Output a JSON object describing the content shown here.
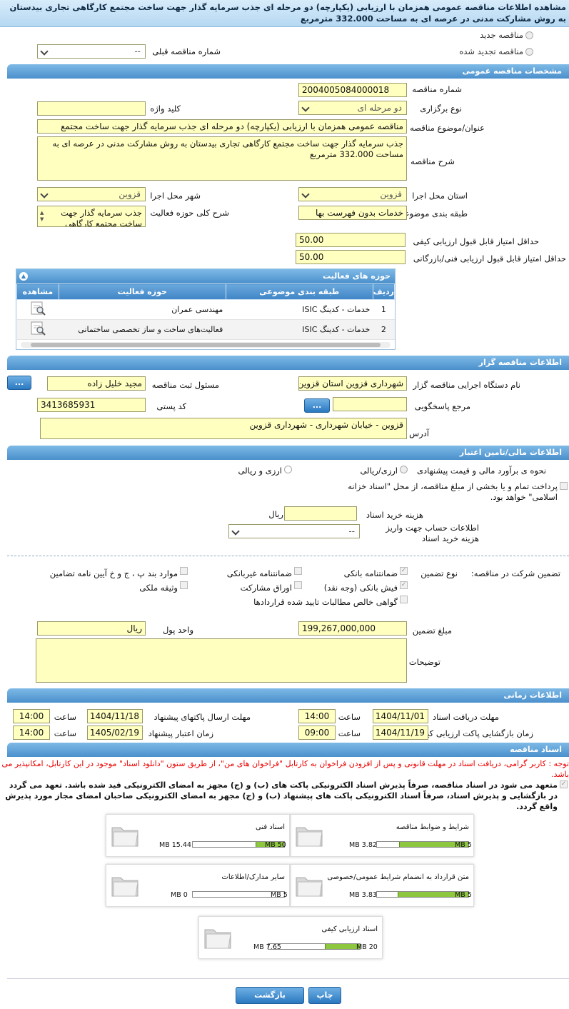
{
  "title": "مشاهده اطلاعات مناقصه عمومی همزمان با ارزیابی (یکپارچه) دو مرحله ای جذب سرمایه گذار جهت ساخت مجتمع کارگاهی تجاری بیدستان به روش مشارکت مدنی در عرصه ای به مساحت 332.000 مترمربع",
  "top": {
    "new_tender": "مناقصه جدید",
    "renewed_tender": "مناقصه تجدید شده",
    "prev_tender_label": "شماره مناقصه قبلی",
    "prev_tender_value": "--"
  },
  "sections": {
    "general": "مشخصات مناقصه عمومی",
    "organizer": "اطلاعات مناقصه گزار",
    "financial": "اطلاعات مالی/تامین اعتبار",
    "timing": "اطلاعات زمانی",
    "documents": "اسناد مناقصه"
  },
  "general": {
    "tender_number_label": "شماره مناقصه",
    "tender_number": "2004005084000018",
    "type_label": "نوع برگزاری",
    "type_value": "دو مرحله ای",
    "keyword_label": "کلید واژه",
    "keyword_value": "",
    "subject_label": "عنوان/موضوع مناقصه",
    "subject_value": "مناقصه عمومی همزمان با ارزیابی (یکپارچه) دو مرحله ای جذب سرمایه گذار جهت ساخت مجتمع",
    "desc_label": "شرح مناقصه",
    "desc_value": "جذب سرمایه گذار جهت ساخت مجتمع کارگاهی تجاری بیدستان  به روش مشارکت مدنی در عرصه ای به مساحت 332.000 مترمربع",
    "province_label": "استان محل اجرا",
    "province_value": "قزوین",
    "city_label": "شهر محل اجرا",
    "city_value": "قزوین",
    "category_label": "طبقه بندی موضوعی",
    "category_value": "خدمات بدون فهرست بها",
    "activity_desc_label": "شرح کلی حوزه فعالیت",
    "activity_desc_value": "جذب سرمایه گذار جهت ساخت مجتمع کارگاهی",
    "min_quality_label": "حداقل امتیاز قابل قبول ارزیابی کیفی",
    "min_quality_value": "50.00",
    "min_tech_label": "حداقل امتیاز قابل قبول ارزیابی فنی/بازرگانی",
    "min_tech_value": "50.00"
  },
  "activity_table": {
    "title": "حوزه های فعالیت",
    "headers": [
      "ردیف",
      "طبقه بندی موضوعی",
      "حوزه فعالیت",
      "مشاهده"
    ],
    "rows": [
      {
        "idx": "1",
        "category": "خدمات - کدینگ ISIC",
        "field": "مهندسی عمران"
      },
      {
        "idx": "2",
        "category": "خدمات - کدینگ ISIC",
        "field": "فعالیت‌های ساخت و ساز تخصصی ساختمانی"
      }
    ]
  },
  "organizer": {
    "org_label": "نام دستگاه اجرایی مناقصه گزار",
    "org_value": "شهرداری قزوین استان قزوین",
    "resp_label": "مسئول ثبت مناقصه",
    "resp_value": "مجید خلیل زاده",
    "ref_label": "مرجع پاسخگویی",
    "ref_value": "",
    "postal_label": "کد پستی",
    "postal_value": "3413685931",
    "address_label": "آدرس",
    "address_value": "قزوین - خیابان شهرداری - شهرداری قزوین",
    "btn_dots": "..."
  },
  "financial": {
    "estimate_label": "نحوه ی برآورد مالی و قیمت پیشنهادی",
    "opt1": "ارزی/ریالی",
    "opt2": "ارزی و ریالی",
    "treasury_text": "پرداخت تمام و یا بخشی از مبلغ مناقصه، از محل \"اسناد خزانه اسلامی\" خواهد بود.",
    "doc_cost_label": "هزینه خرید اسناد",
    "doc_cost_value": "",
    "doc_cost_unit": "ریال",
    "account_label": "اطلاعات حساب جهت واریز هزینه خرید اسناد",
    "account_value": "--"
  },
  "guarantee": {
    "label": "تضمین شرکت در مناقصه:",
    "type_label": "نوع تضمین",
    "options": [
      {
        "text": "ضمانتنامه بانکی",
        "checked": true
      },
      {
        "text": "ضمانتنامه غیربانکی",
        "checked": false
      },
      {
        "text": "موارد بند پ ، ج و خ آیین نامه تضامین",
        "checked": false
      },
      {
        "text": "فیش بانکی (وجه نقد)",
        "checked": true
      },
      {
        "text": "اوراق مشارکت",
        "checked": false
      },
      {
        "text": "وثیقه ملکی",
        "checked": false
      },
      {
        "text": "گواهی خالص مطالبات تایید شده قراردادها",
        "checked": false
      }
    ],
    "amount_label": "مبلغ تضمین",
    "amount_value": "199,267,000,000",
    "currency_label": "واحد پول",
    "currency_value": "ریال",
    "notes_label": "توضیحات",
    "notes_value": ""
  },
  "timing": {
    "receive_label": "مهلت دریافت اسناد",
    "receive_date": "1404/11/01",
    "receive_time": "14:00",
    "send_label": "مهلت ارسال پاکتهای پیشنهاد",
    "send_date": "1404/11/18",
    "send_time": "14:00",
    "open_label": "زمان بازگشایی پاکت ارزیابی کیفی",
    "open_date": "1404/11/19",
    "open_time": "09:00",
    "valid_label": "زمان اعتبار پیشنهاد",
    "valid_date": "1405/02/19",
    "valid_time": "14:00",
    "hour_label": "ساعت"
  },
  "documents": {
    "notice": "توجه : کاربر گرامی، دریافت اسناد در مهلت قانونی و پس از افزودن فراخوان به کارتابل \"فراخوان های من\"، از طریق ستون \"دانلود اسناد\" موجود در این کارتابل، امکانپذیر می باشد.",
    "commit": "متعهد می شود در اسناد مناقصه، صرفاً پذیرش اسناد الکترونیکی پاکت های (ب) و (ج) مجهز به امضای الکترونیکی قید شده باشد. تعهد می گردد در بازگشایی و پذیرش اسناد، صرفاً اسناد الکترونیکی پاکت های پیشنهاد (ب) و (ج) مجهز به امضای الکترونیکی صاحبان امضای مجاز مورد پذیرش واقع گردد.",
    "files": [
      {
        "name": "شرایط و ضوابط مناقصه",
        "size": "3.82 MB",
        "max": "5 MB",
        "fraction": 0.76
      },
      {
        "name": "اسناد فنی",
        "size": "15.44 MB",
        "max": "50 MB",
        "fraction": 0.31
      },
      {
        "name": "متن قرارداد به انضمام شرایط عمومی/خصوصی",
        "size": "3.83 MB",
        "max": "5 MB",
        "fraction": 0.77
      },
      {
        "name": "سایر مدارک/اطلاعات",
        "size": "0 MB",
        "max": "5 MB",
        "fraction": 0.0
      },
      {
        "name": "اسناد ارزیابی کیفی",
        "size": "7.65 MB",
        "max": "20 MB",
        "fraction": 0.38
      }
    ]
  },
  "footer": {
    "print": "چاپ",
    "back": "بازگشت"
  }
}
